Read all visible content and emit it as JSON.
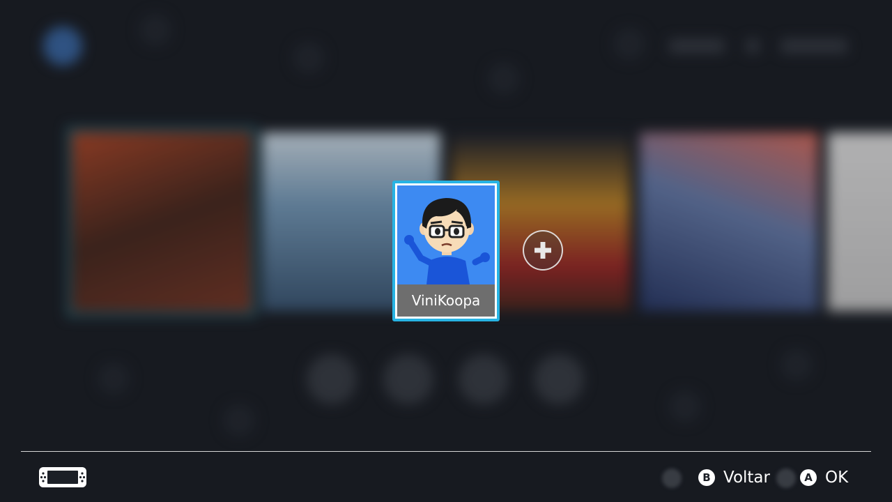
{
  "user_card": {
    "name": "ViniKoopa"
  },
  "add_user": {
    "icon": "plus-icon"
  },
  "footer": {
    "console_icon": "switch-console-icon",
    "back": {
      "button": "B",
      "label": "Voltar"
    },
    "ok": {
      "button": "A",
      "label": "OK"
    }
  },
  "colors": {
    "selection_border": "#27b3e3",
    "avatar_background": "#3d8af2",
    "name_bar": "#6e6e6e",
    "background": "#1b1f26"
  }
}
